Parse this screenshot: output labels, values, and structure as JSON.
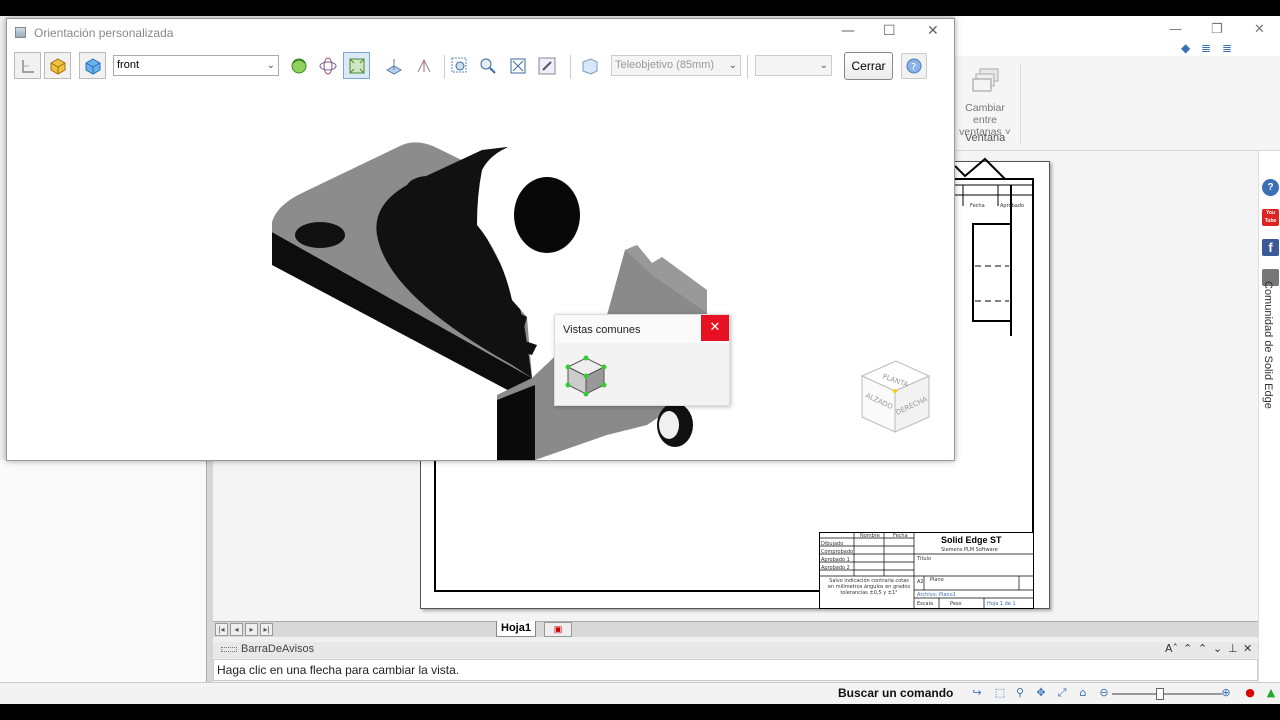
{
  "dialog": {
    "title": "Orientación personalizada",
    "view_combo": "front",
    "lens_combo": "Teleobjetivo (85mm)",
    "blank_combo": "",
    "close_label": "Cerrar"
  },
  "popup": {
    "title": "Vistas comunes"
  },
  "view_cube": {
    "top_label": "PLANTA",
    "front_label": "ALZADO",
    "right_label": "DERECHA"
  },
  "ribbon": {
    "switch_windows_label_line1": "Cambiar entre",
    "switch_windows_label_line2": "ventanas ˅",
    "group_label": "Ventana"
  },
  "sidebar": {
    "youtube_label": "You Tube",
    "facebook_label": "f",
    "community_label": "Comunidad de Solid Edge"
  },
  "sheet": {
    "header_fecha": "Fecha",
    "header_aprobado": "Aprobado",
    "title_block": {
      "col_nombre": "Nombre",
      "col_fecha": "Fecha",
      "row_dibujado": "Dibujado",
      "row_comprobado": "Comprobado",
      "row_aprobado1": "Aprobado 1",
      "row_aprobado2": "Aprobado 2",
      "company": "Solid Edge ST",
      "subtitle": "Siemens PLM Software",
      "titulo": "Título",
      "plano": "Plano",
      "size": "A2",
      "archivo": "Archivo: Plano1",
      "escala": "Escala",
      "peso": "Peso",
      "hoja": "Hoja 1 de 1",
      "note": "Salvo indicación contraria cotas en milímetros ángulos en grados tolerancias ±0,5 y ±1°"
    }
  },
  "tabs": {
    "sheet_tab": "Hoja1"
  },
  "notices": {
    "bar_title": "BarraDeAvisos",
    "message": "Haga clic en una flecha para cambiar la vista."
  },
  "status": {
    "search_command": "Buscar un comando"
  },
  "colors": {
    "close_red": "#e81123",
    "accent_blue": "#3b6fb6"
  }
}
